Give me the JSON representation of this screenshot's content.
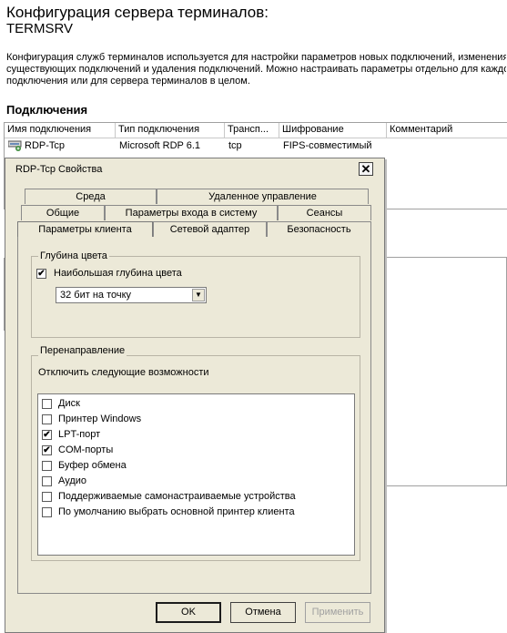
{
  "page": {
    "title": "Конфигурация сервера терминалов:",
    "server": "TERMSRV",
    "description_lines": [
      "Конфигурация служб терминалов используется для настройки параметров новых подключений, изменения",
      "существующих подключений и удаления подключений. Можно настраивать параметры отдельно для каждо",
      "подключения или для сервера терминалов в целом."
    ],
    "section_title": "Подключения"
  },
  "connections": {
    "columns": [
      "Имя подключения",
      "Тип подключения",
      "Трансп...",
      "Шифрование",
      "Комментарий"
    ],
    "rows": [
      {
        "name": "RDP-Tcp",
        "type": "Microsoft RDP 6.1",
        "transport": "tcp",
        "encryption": "FIPS-совместимый",
        "comment": ""
      }
    ]
  },
  "dialog": {
    "title": "RDP-Tcp Свойства",
    "close_glyph": "✕",
    "tabs_row1": [
      "Среда",
      "Удаленное управление"
    ],
    "tabs_row2": [
      "Общие",
      "Параметры входа в систему",
      "Сеансы"
    ],
    "tabs_row3": [
      "Параметры клиента",
      "Сетевой адаптер",
      "Безопасность"
    ],
    "color_group": {
      "label": "Глубина цвета",
      "max_depth_label": "Наибольшая глубина цвета",
      "max_depth_checked": true,
      "selected_depth": "32 бит на точку"
    },
    "redirect_group": {
      "label": "Перенаправление",
      "hint": "Отключить следующие возможности",
      "items": [
        {
          "label": "Диск",
          "checked": false
        },
        {
          "label": "Принтер Windows",
          "checked": false
        },
        {
          "label": "LPT-порт",
          "checked": true
        },
        {
          "label": "COM-порты",
          "checked": true
        },
        {
          "label": "Буфер обмена",
          "checked": false
        },
        {
          "label": "Аудио",
          "checked": false
        },
        {
          "label": "Поддерживаемые самонастраиваемые устройства",
          "checked": false
        },
        {
          "label": "По умолчанию выбрать основной принтер клиента",
          "checked": false
        }
      ]
    },
    "buttons": {
      "ok": "OK",
      "cancel": "Отмена",
      "apply": "Применить"
    },
    "check_glyph": "✔",
    "dropdown_glyph": "▼"
  }
}
